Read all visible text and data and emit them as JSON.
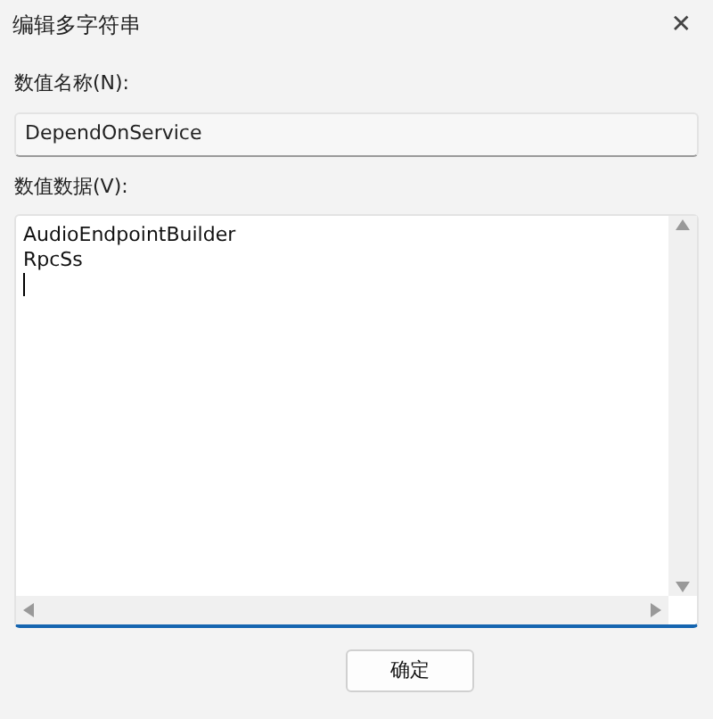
{
  "window": {
    "title": "编辑多字符串",
    "close": "✕"
  },
  "value_name": {
    "label": "数值名称(N):",
    "value": "DependOnService"
  },
  "value_data": {
    "label": "数值数据(V):",
    "lines": [
      "AudioEndpointBuilder",
      "RpcSs"
    ]
  },
  "buttons": [
    {
      "label": "确定"
    }
  ]
}
